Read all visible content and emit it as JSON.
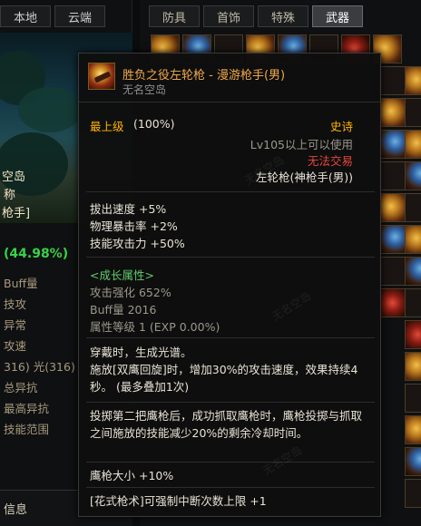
{
  "left_panel": {
    "tabs": [
      "本地",
      "云端"
    ],
    "scene_lines": [
      "空岛",
      "称",
      "枪手]"
    ],
    "percent": "(44.98%)",
    "stats": [
      "Buff量",
      "技攻",
      "异常",
      "攻速",
      "316) 光(316)",
      "总异抗",
      "最高异抗",
      "技能范围"
    ],
    "bottom_label": "信息"
  },
  "right_panel": {
    "tabs": [
      "防具",
      "首饰",
      "特殊",
      "武器"
    ],
    "active_tab": "武器"
  },
  "tooltip": {
    "name": "胜负之役左轮枪 - 漫游枪手(男)",
    "subtitle": "无名空岛",
    "grade_label": "最上级",
    "grade_pct": "(100%)",
    "rarity": "史诗",
    "level_req": "Lv105以上可以使用",
    "trade": "无法交易",
    "weapon_type": "左轮枪(神枪手(男))",
    "stats": [
      "拔出速度 +5%",
      "物理暴击率 +2%",
      "技能攻击力 +50%"
    ],
    "growth_header": "<成长属性>",
    "growth": [
      "攻击强化 652%",
      "Buff量 2016",
      "属性等级 1 (EXP 0.00%)"
    ],
    "effects": [
      "穿戴时，生成光谱。",
      "施放[双鹰回旋]时，增加30%的攻击速度，效果持续4秒。 (最多叠加1次)",
      "投掷第二把鹰枪后，成功抓取鹰枪时，鹰枪投掷与抓取之间施放的技能减少20%的剩余冷却时间。",
      "鹰枪大小 +10%",
      "[花式枪术]可强制中断次数上限 +1"
    ]
  },
  "watermark": "无名空岛",
  "colors": {
    "epic": "#ffb400",
    "name": "#f2a94a",
    "untradeable": "#e5463c",
    "growth": "#5fcd6a",
    "percent_green": "#39d14a"
  }
}
